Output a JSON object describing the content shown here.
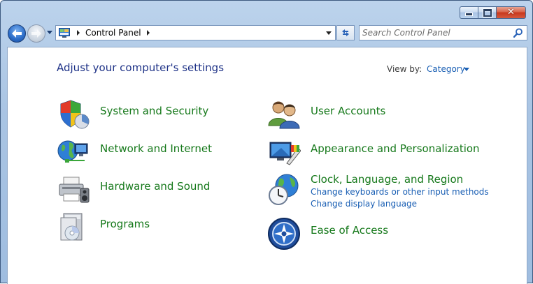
{
  "window": {
    "caption_minimize": "minimize",
    "caption_maximize": "maximize",
    "caption_close": "close"
  },
  "address_bar": {
    "breadcrumb": "Control Panel"
  },
  "search": {
    "placeholder": "Search Control Panel"
  },
  "header": {
    "title": "Adjust your computer's settings",
    "view_by_label": "View by:",
    "view_by_value": "Category"
  },
  "categories_left": [
    {
      "title": "System and Security",
      "icon": "shield-icon"
    },
    {
      "title": "Network and Internet",
      "icon": "globe-network-icon"
    },
    {
      "title": "Hardware and Sound",
      "icon": "printer-icon"
    },
    {
      "title": "Programs",
      "icon": "programs-icon"
    }
  ],
  "categories_right": [
    {
      "title": "User Accounts",
      "icon": "users-icon"
    },
    {
      "title": "Appearance and Personalization",
      "icon": "monitor-palette-icon"
    },
    {
      "title": "Clock, Language, and Region",
      "icon": "clock-globe-icon",
      "links": [
        "Change keyboards or other input methods",
        "Change display language"
      ]
    },
    {
      "title": "Ease of Access",
      "icon": "ease-of-access-icon"
    }
  ],
  "colors": {
    "category_title": "#16791b",
    "link": "#1a5fb4",
    "heading": "#1e3287"
  }
}
